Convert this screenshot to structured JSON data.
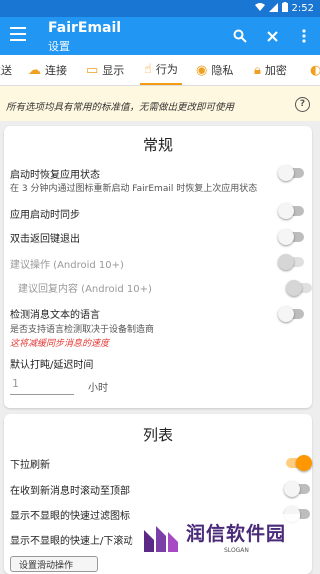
{
  "status": {
    "time": "2:52"
  },
  "appbar": {
    "title": "FairEmail",
    "subtitle": "设置"
  },
  "tabs": [
    {
      "label": "发送"
    },
    {
      "label": "连接"
    },
    {
      "label": "显示"
    },
    {
      "label": "行为"
    },
    {
      "label": "隐私"
    },
    {
      "label": "加密"
    }
  ],
  "hint": {
    "text": "所有选项均具有常用的标准值，无需做出更改即可使用"
  },
  "general": {
    "title": "常规",
    "restore_label": "启动时恢复应用状态",
    "restore_desc": "在 3 分钟内通过图标重新启动 FairEmail 时恢复上次应用状态",
    "sync_label": "应用启动时同步",
    "double_back_label": "双击返回键退出",
    "suggest_label": "建议操作 (Android 10+)",
    "suggest_reply_label": "建议回复内容 (Android 10+)",
    "detect_lang_label": "检测消息文本的语言",
    "detect_lang_desc": "是否支持语言检测取决于设备制造商",
    "detect_lang_warn": "这将减缓同步消息的速度",
    "default_snooze_label": "默认打盹/延迟时间",
    "default_snooze_value": "1",
    "default_snooze_unit": "小时"
  },
  "list": {
    "title": "列表",
    "pull_refresh_label": "下拉刷新",
    "scroll_top_label": "在收到新消息时滚动至顶部",
    "quick_filter_label": "显示不显眼的快速过滤图标",
    "quick_scroll_label": "显示不显眼的快速上/下滚动",
    "swipe_actions_label": "设置滑动操作"
  },
  "watermark": {
    "text": "润信软件园",
    "slogan": "SLOGAN"
  }
}
